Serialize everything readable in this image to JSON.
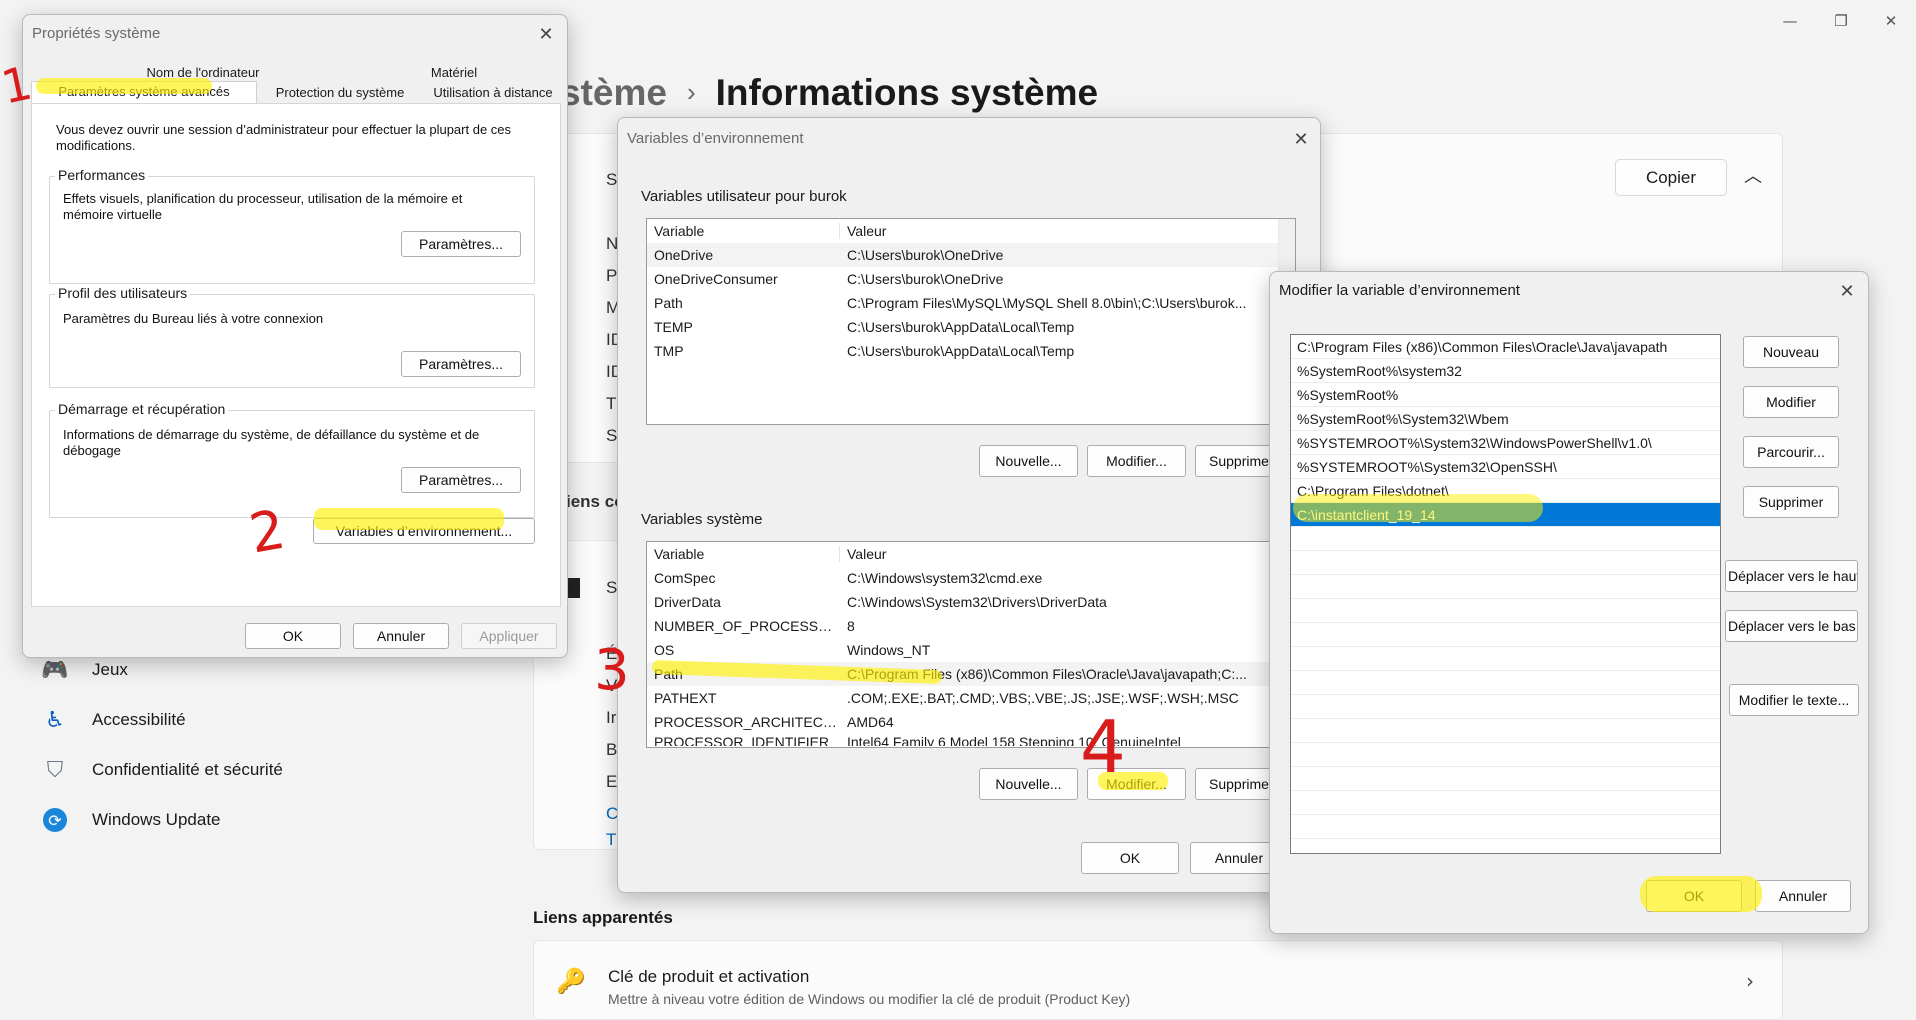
{
  "settings": {
    "breadcrumb_parent": "stème",
    "breadcrumb_sep": "›",
    "page_title": "Informations système",
    "copy_label": "Copier",
    "collapse_glyph": "︿",
    "win_minimize": "—",
    "win_restore": "❐",
    "win_close": "✕",
    "peek_letters": [
      "S",
      "N",
      "P",
      "M",
      "ID",
      "ID",
      "T",
      "S"
    ],
    "peek_section": "iens co",
    "peek_s2": "S",
    "peek_letters2": [
      "É",
      "V",
      "Ir",
      "B",
      "E",
      "C",
      "T"
    ],
    "nav": [
      {
        "label": "Jeux",
        "icon": "gamepad-icon",
        "glyph": "🎮"
      },
      {
        "label": "Accessibilité",
        "icon": "accessibility-icon",
        "glyph": "♿"
      },
      {
        "label": "Confidentialité et sécurité",
        "icon": "shield-icon",
        "glyph": "⛉"
      },
      {
        "label": "Windows Update",
        "icon": "windows-update-icon",
        "glyph": "⟳"
      }
    ],
    "related_title": "Liens apparentés",
    "related_item_title": "Clé de produit et activation",
    "related_item_desc": "Mettre à niveau votre édition de Windows ou modifier la clé de produit (Product Key)",
    "related_chevron": "›",
    "key_glyph": "🔑"
  },
  "sysprops": {
    "title": "Propriétés système",
    "close_glyph": "✕",
    "tabs_top": [
      "Nom de l'ordinateur",
      "Matériel"
    ],
    "tabs_bottom": [
      "Paramètres système avancés",
      "Protection du système",
      "Utilisation à distance"
    ],
    "admin_note": "Vous devez ouvrir une session d’administrateur pour effectuer la plupart de ces modifications.",
    "perf_label": "Performances",
    "perf_desc": "Effets visuels, planification du processeur, utilisation de la mémoire et mémoire virtuelle",
    "profile_label": "Profil des utilisateurs",
    "profile_desc": "Paramètres du Bureau liés à votre connexion",
    "startup_label": "Démarrage et récupération",
    "startup_desc": "Informations de démarrage du système, de défaillance du système et de débogage",
    "settings_btn": "Paramètres...",
    "env_btn": "Variables d’environnement...",
    "ok": "OK",
    "cancel": "Annuler",
    "apply": "Appliquer"
  },
  "envvars": {
    "title": "Variables d’environnement",
    "close_glyph": "✕",
    "user_group": "Variables utilisateur pour burok",
    "col_variable": "Variable",
    "col_value": "Valeur",
    "user_vars": [
      {
        "name": "OneDrive",
        "value": "C:\\Users\\burok\\OneDrive"
      },
      {
        "name": "OneDriveConsumer",
        "value": "C:\\Users\\burok\\OneDrive"
      },
      {
        "name": "Path",
        "value": "C:\\Program Files\\MySQL\\MySQL Shell 8.0\\bin\\;C:\\Users\\burok..."
      },
      {
        "name": "TEMP",
        "value": "C:\\Users\\burok\\AppData\\Local\\Temp"
      },
      {
        "name": "TMP",
        "value": "C:\\Users\\burok\\AppData\\Local\\Temp"
      }
    ],
    "system_group": "Variables système",
    "sys_vars": [
      {
        "name": "ComSpec",
        "value": "C:\\Windows\\system32\\cmd.exe"
      },
      {
        "name": "DriverData",
        "value": "C:\\Windows\\System32\\Drivers\\DriverData"
      },
      {
        "name": "NUMBER_OF_PROCESSORS",
        "value": "8"
      },
      {
        "name": "OS",
        "value": "Windows_NT"
      },
      {
        "name": "Path",
        "value": "C:\\Program Files (x86)\\Common Files\\Oracle\\Java\\javapath;C:..."
      },
      {
        "name": "PATHEXT",
        "value": ".COM;.EXE;.BAT;.CMD;.VBS;.VBE;.JS;.JSE;.WSF;.WSH;.MSC"
      },
      {
        "name": "PROCESSOR_ARCHITECTU...",
        "value": "AMD64"
      },
      {
        "name": "PROCESSOR_IDENTIFIER",
        "value": "Intel64 Family 6 Model 158 Stepping 10, GenuineIntel"
      }
    ],
    "new_btn": "Nouvelle...",
    "edit_btn": "Modifier...",
    "delete_btn": "Supprimer",
    "ok": "OK",
    "cancel": "Annuler"
  },
  "editvar": {
    "title": "Modifier la variable d’environnement",
    "close_glyph": "✕",
    "paths": [
      "C:\\Program Files (x86)\\Common Files\\Oracle\\Java\\javapath",
      "%SystemRoot%\\system32",
      "%SystemRoot%",
      "%SystemRoot%\\System32\\Wbem",
      "%SYSTEMROOT%\\System32\\WindowsPowerShell\\v1.0\\",
      "%SYSTEMROOT%\\System32\\OpenSSH\\",
      "C:\\Program Files\\dotnet\\",
      "C:\\instantclient_19_14"
    ],
    "selected_index": 7,
    "new_btn": "Nouveau",
    "edit_btn": "Modifier",
    "browse_btn": "Parcourir...",
    "delete_btn": "Supprimer",
    "move_up_btn": "Déplacer vers le haut",
    "move_down_btn": "Déplacer vers le bas",
    "edit_text_btn": "Modifier le texte...",
    "ok": "OK",
    "cancel": "Annuler"
  },
  "annotations": {
    "step1": "1",
    "step2": "2",
    "step3": "3",
    "step4": "4"
  },
  "colors": {
    "selection": "#0078d7",
    "highlight": "#fff000",
    "annotation": "#d81c1c"
  }
}
